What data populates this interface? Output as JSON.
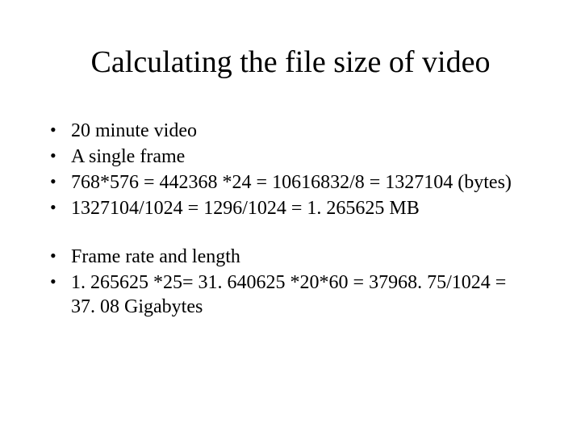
{
  "title": "Calculating the file size of video",
  "group1": {
    "b1": "20 minute video",
    "b2": "A single frame",
    "b3": "768*576 = 442368 *24 = 10616832/8 = 1327104 (bytes)",
    "b4": "1327104/1024 = 1296/1024 = 1. 265625 MB"
  },
  "group2": {
    "b1": "Frame rate and length",
    "b2": "1. 265625 *25= 31. 640625 *20*60 = 37968. 75/1024 = 37. 08 Gigabytes"
  }
}
